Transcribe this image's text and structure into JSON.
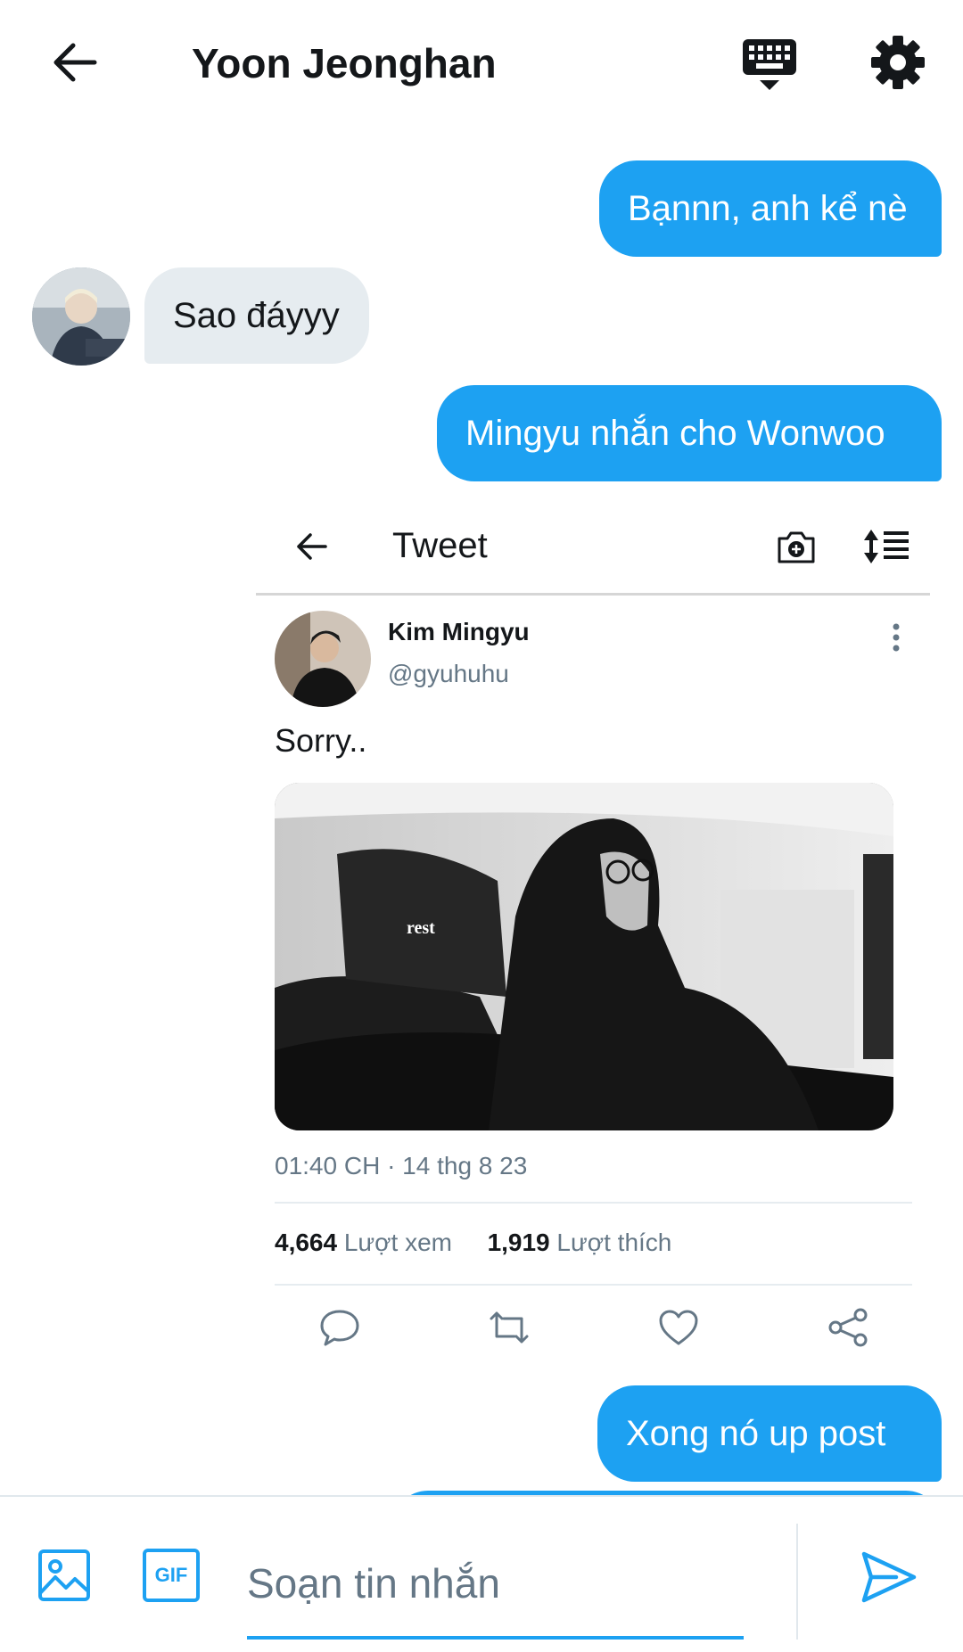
{
  "header": {
    "title": "Yoon Jeonghan",
    "icons": [
      "back-arrow-icon",
      "keyboard-icon",
      "gear-icon"
    ]
  },
  "messages": [
    {
      "from": "me",
      "text": "Bạnnn, anh kể nè"
    },
    {
      "from": "them",
      "text": "Sao đáyyy"
    },
    {
      "from": "me",
      "text": "Mingyu nhắn cho Wonwoo"
    },
    {
      "from": "me",
      "text": "Xong nó up post"
    }
  ],
  "tweet": {
    "topbar_title": "Tweet",
    "author_name": "Kim Mingyu",
    "author_handle": "@gyuhuhu",
    "text": "Sorry..",
    "image_overlay_text": "rest",
    "timestamp": "01:40 CH · 14 thg 8 23",
    "views_count": "4,664",
    "views_label": "Lượt xem",
    "likes_count": "1,919",
    "likes_label": "Lượt thích"
  },
  "composer": {
    "placeholder": "Soạn tin nhắn",
    "gif_label": "GIF"
  },
  "colors": {
    "accent": "#1da1f2",
    "incoming_bubble": "#e6ecf0",
    "muted_text": "#657786"
  }
}
